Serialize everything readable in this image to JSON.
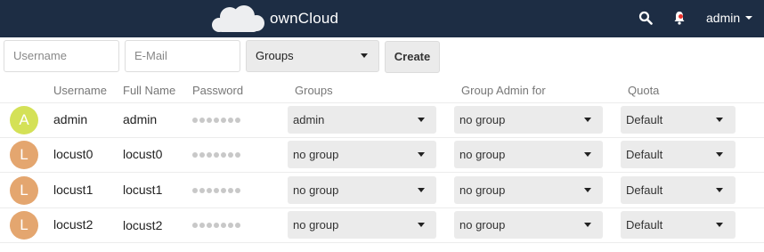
{
  "header": {
    "brand": "ownCloud",
    "user_label": "admin",
    "icons": {
      "logo": "cloud-logo",
      "search": "search-icon",
      "notifications": "bell-icon",
      "menu": "caret-down-icon"
    },
    "colors": {
      "background": "#1d2d44",
      "text": "#ffffff",
      "notification_dot": "#e9322d"
    }
  },
  "new_user": {
    "username_placeholder": "Username",
    "email_placeholder": "E-Mail",
    "groups_label": "Groups",
    "create_label": "Create"
  },
  "table": {
    "columns": [
      "Username",
      "Full Name",
      "Password",
      "Groups",
      "Group Admin for",
      "Quota"
    ],
    "rows": [
      {
        "avatar_letter": "A",
        "avatar_color": "#d4e157",
        "username": "admin",
        "full_name": "admin",
        "groups": "admin",
        "group_admin": "no group",
        "quota": "Default"
      },
      {
        "avatar_letter": "L",
        "avatar_color": "#e4a66f",
        "username": "locust0",
        "full_name": "locust0",
        "groups": "no group",
        "group_admin": "no group",
        "quota": "Default"
      },
      {
        "avatar_letter": "L",
        "avatar_color": "#e4a66f",
        "username": "locust1",
        "full_name": "locust1",
        "groups": "no group",
        "group_admin": "no group",
        "quota": "Default"
      },
      {
        "avatar_letter": "L",
        "avatar_color": "#e4a66f",
        "username": "locust2",
        "full_name": "locust2",
        "groups": "no group",
        "group_admin": "no group",
        "quota": "Default"
      }
    ]
  }
}
